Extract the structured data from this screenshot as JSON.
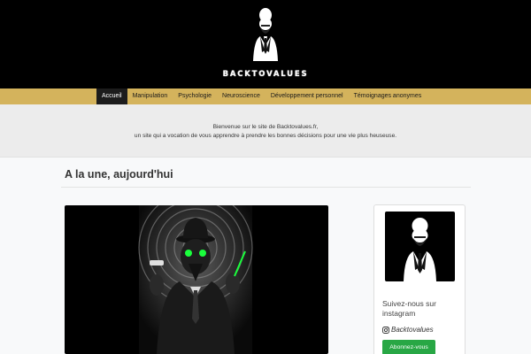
{
  "site": {
    "brand": "Backtovalues"
  },
  "nav": {
    "items": [
      {
        "label": "Accueil",
        "active": true
      },
      {
        "label": "Manipulation",
        "active": false
      },
      {
        "label": "Psychologie",
        "active": false
      },
      {
        "label": "Neuroscience",
        "active": false
      },
      {
        "label": "Développement personnel",
        "active": false
      },
      {
        "label": "Témoignages anonymes",
        "active": false
      }
    ]
  },
  "welcome": {
    "line1": "Bienvenue sur le site de Backtovalues.fr,",
    "line2": "un site qui a vocation de vous apprendre à prendre les bonnes décisions pour une vie plus heuseuse."
  },
  "main": {
    "section_title": "A la une, aujourd'hui"
  },
  "sidebar": {
    "follow_text": "Suivez-nous sur instagram",
    "handle": "Backtovalues",
    "subscribe_label": "Abonnez-vous"
  },
  "colors": {
    "header_bg": "#000000",
    "nav_bg": "#d4b35c",
    "nav_active_bg": "#1c1c1c",
    "welcome_bg": "#ececec",
    "accent_green": "#28a745"
  },
  "icons": {
    "logo": "masked-man-logo-icon",
    "instagram": "instagram-icon"
  }
}
